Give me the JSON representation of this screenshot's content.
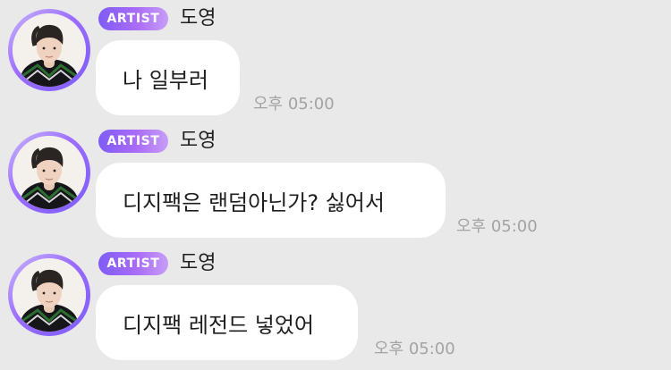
{
  "chat": {
    "messages": [
      {
        "badge": "ARTIST",
        "sender": "도영",
        "text": "나 일부러",
        "time": "오후 05:00"
      },
      {
        "badge": "ARTIST",
        "sender": "도영",
        "text": "디지팩은 랜덤아닌가? 싫어서",
        "time": "오후 05:00"
      },
      {
        "badge": "ARTIST",
        "sender": "도영",
        "text": "디지팩 레전드 넣었어",
        "time": "오후 05:00"
      }
    ]
  },
  "colors": {
    "background": "#e9e9ea",
    "bubble": "#ffffff",
    "badge_start": "#7f5cf6",
    "badge_end": "#c79df7",
    "timestamp": "#a3a3a3"
  },
  "icons": {
    "avatar": "artist-profile-photo"
  }
}
